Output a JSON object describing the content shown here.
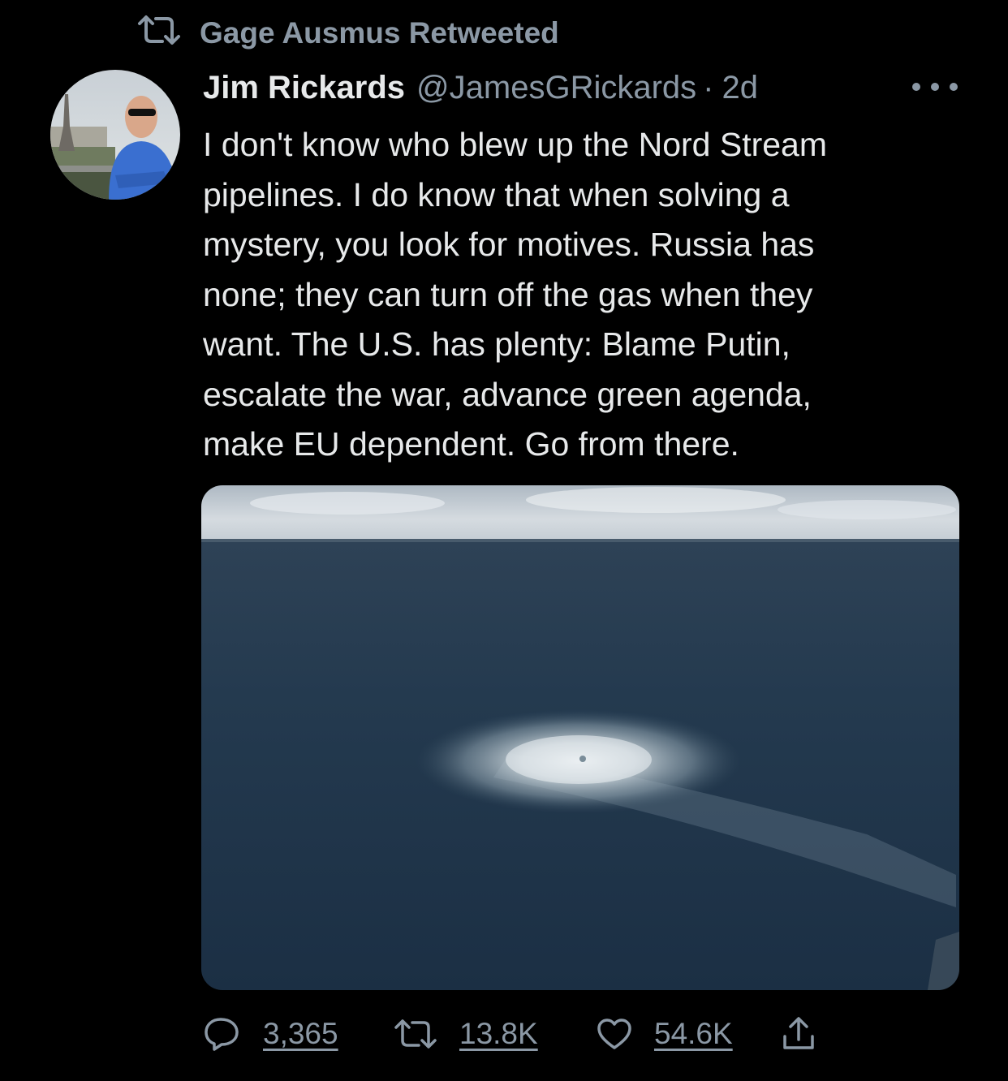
{
  "social_context": {
    "icon": "retweet-icon",
    "text": "Gage Ausmus Retweeted"
  },
  "tweet": {
    "author_name": "Jim Rickards",
    "handle": "@JamesGRickards",
    "separator": "·",
    "time": "2d",
    "text": "I don't know who blew up the Nord Stream\npipelines. I do know that when solving a\nmystery, you look for motives. Russia has\nnone; they can turn off the gas when they\nwant. The U.S. has plenty: Blame Putin,\nescalate the war, advance green agenda,\nmake EU dependent. Go from there.",
    "more_icon": "more-horizontal-icon"
  },
  "actions": {
    "reply": {
      "icon": "reply-icon",
      "count": "3,365"
    },
    "retweet": {
      "icon": "retweet-icon",
      "count": "13.8K"
    },
    "like": {
      "icon": "heart-icon",
      "count": "54.6K"
    },
    "share": {
      "icon": "share-icon"
    }
  },
  "colors": {
    "background": "#000000",
    "primary_text": "#e7e9ea",
    "secondary_text": "#8b98a5"
  }
}
